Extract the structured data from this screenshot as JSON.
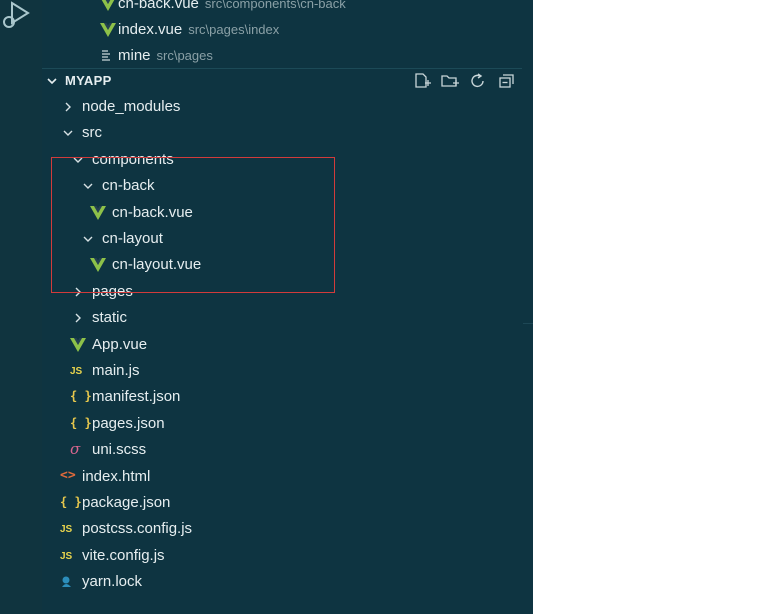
{
  "activity_bar": {
    "icon": "run-debug-icon"
  },
  "open_editors": [
    {
      "name": "cn-back.vue",
      "path": "src\\components\\cn-back",
      "icon": "vue-icon"
    },
    {
      "name": "index.vue",
      "path": "src\\pages\\index",
      "icon": "vue-icon"
    },
    {
      "name": "mine",
      "path": "src\\pages",
      "icon": "file-lines-icon"
    }
  ],
  "explorer": {
    "title": "MYAPP",
    "toolbar": [
      "new-file-icon",
      "new-folder-icon",
      "refresh-icon",
      "collapse-all-icon"
    ]
  },
  "tree": [
    {
      "label": "node_modules",
      "type": "folder",
      "expanded": false,
      "depth": 0
    },
    {
      "label": "src",
      "type": "folder",
      "expanded": true,
      "depth": 0
    },
    {
      "label": "components",
      "type": "folder",
      "expanded": true,
      "depth": 1
    },
    {
      "label": "cn-back",
      "type": "folder",
      "expanded": true,
      "depth": 2
    },
    {
      "label": "cn-back.vue",
      "type": "vue",
      "depth": 3
    },
    {
      "label": "cn-layout",
      "type": "folder",
      "expanded": true,
      "depth": 2
    },
    {
      "label": "cn-layout.vue",
      "type": "vue",
      "depth": 3
    },
    {
      "label": "pages",
      "type": "folder",
      "expanded": false,
      "depth": 1
    },
    {
      "label": "static",
      "type": "folder",
      "expanded": false,
      "depth": 1
    },
    {
      "label": "App.vue",
      "type": "vue",
      "depth": 1
    },
    {
      "label": "main.js",
      "type": "js",
      "depth": 1
    },
    {
      "label": "manifest.json",
      "type": "json",
      "depth": 1
    },
    {
      "label": "pages.json",
      "type": "json",
      "depth": 1
    },
    {
      "label": "uni.scss",
      "type": "scss",
      "depth": 1
    },
    {
      "label": "index.html",
      "type": "html",
      "depth": 0
    },
    {
      "label": "package.json",
      "type": "json",
      "depth": 0
    },
    {
      "label": "postcss.config.js",
      "type": "js",
      "depth": 0
    },
    {
      "label": "vite.config.js",
      "type": "js",
      "depth": 0
    },
    {
      "label": "yarn.lock",
      "type": "yarn",
      "depth": 0
    }
  ],
  "icon_glyphs": {
    "js": "JS",
    "json": "{ }",
    "html": "<>",
    "scss": "σ"
  },
  "colors": {
    "sidebar_bg": "#0e3441",
    "vue_green": "#8dc149",
    "js_yellow": "#e8d44d",
    "highlight_red": "#d23b3b"
  }
}
